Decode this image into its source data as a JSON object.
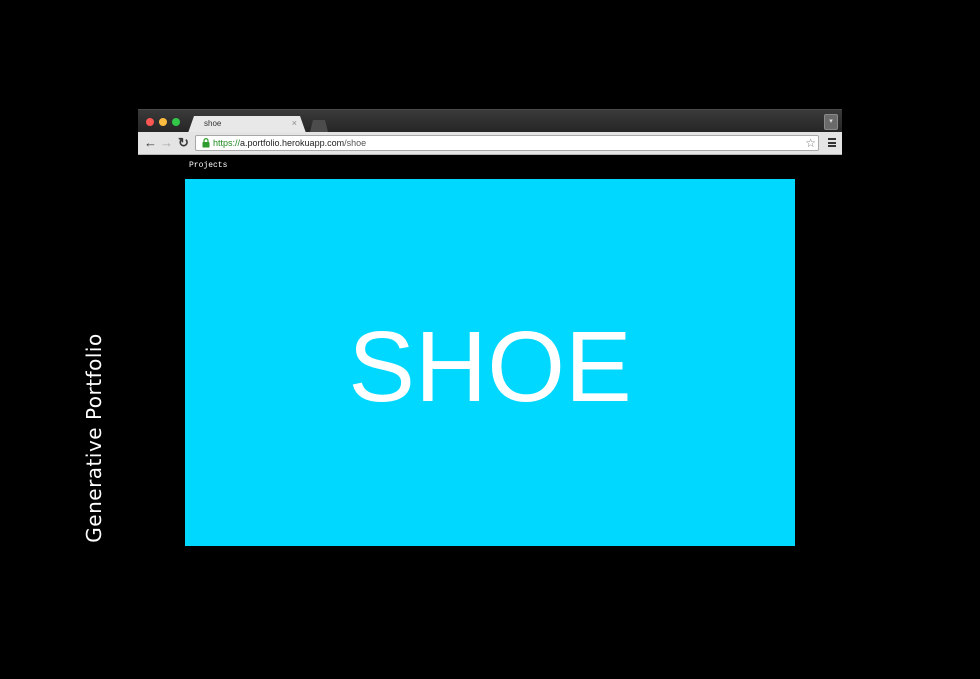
{
  "side_title": "Generative Portfolio",
  "browser": {
    "tab": {
      "title": "shoe",
      "close_glyph": "×"
    },
    "address": {
      "scheme": "https://",
      "host": "a.portfolio.herokuapp.com",
      "path": "/shoe"
    },
    "icons": {
      "back": "back-arrow-icon",
      "forward": "forward-arrow-icon",
      "reload": "reload-icon",
      "lock": "lock-icon",
      "star": "star-icon",
      "menu": "hamburger-menu-icon"
    }
  },
  "page": {
    "nav_link": "Projects",
    "hero": {
      "title": "SHOE",
      "background_color": "#00d8ff",
      "text_color": "#ffffff"
    }
  },
  "colors": {
    "background": "#000000",
    "accent": "#00d8ff",
    "secure_green": "#1e8a1e"
  }
}
